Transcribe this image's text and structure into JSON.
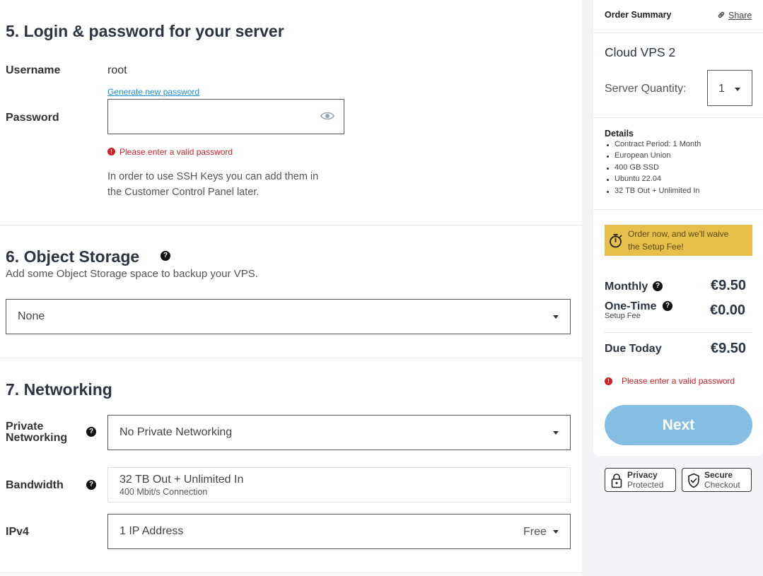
{
  "login": {
    "title": "5. Login & password for your server",
    "username_label": "Username",
    "username_value": "root",
    "generate_link": "Generate new password",
    "password_label": "Password",
    "password_value": "",
    "error": "Please enter a valid password",
    "ssh_note_line1": "In order to use SSH Keys you can add them in",
    "ssh_note_line2": "the Customer Control Panel later."
  },
  "object_storage": {
    "title": "6. Object Storage",
    "subtitle": "Add some Object Storage space to backup your VPS.",
    "selected": "None"
  },
  "networking": {
    "title": "7. Networking",
    "private_label_line1": "Private",
    "private_label_line2": "Networking",
    "private_selected": "No Private Networking",
    "bandwidth_label": "Bandwidth",
    "bandwidth_value": "32 TB Out + Unlimited In",
    "bandwidth_sub": "400 Mbit/s Connection",
    "ipv4_label": "IPv4",
    "ipv4_selected": "1 IP Address",
    "ipv4_price": "Free"
  },
  "summary": {
    "title": "Order Summary",
    "share": "Share",
    "product": "Cloud VPS 2",
    "quantity_label": "Server Quantity:",
    "quantity_value": "1",
    "details_title": "Details",
    "details": [
      "Contract Period: 1 Month",
      "European Union",
      "400 GB SSD",
      "Ubuntu 22.04",
      "32 TB Out + Unlimited In"
    ],
    "promo_line1": "Order now, and we'll waive",
    "promo_line2": "the Setup Fee!",
    "monthly_label": "Monthly",
    "monthly_price": "€9.50",
    "onetime_label": "One-Time",
    "onetime_sub": "Setup Fee",
    "onetime_price": "€0.00",
    "due_label": "Due Today",
    "due_price": "€9.50",
    "error": "Please enter a valid password",
    "next_button": "Next",
    "next_color": "#85bde3",
    "promo_color": "#e5c04a",
    "error_color": "#d0202a"
  },
  "badges": {
    "privacy_line1": "Privacy",
    "privacy_line2": "Protected",
    "secure_line1": "Secure",
    "secure_line2": "Checkout"
  }
}
